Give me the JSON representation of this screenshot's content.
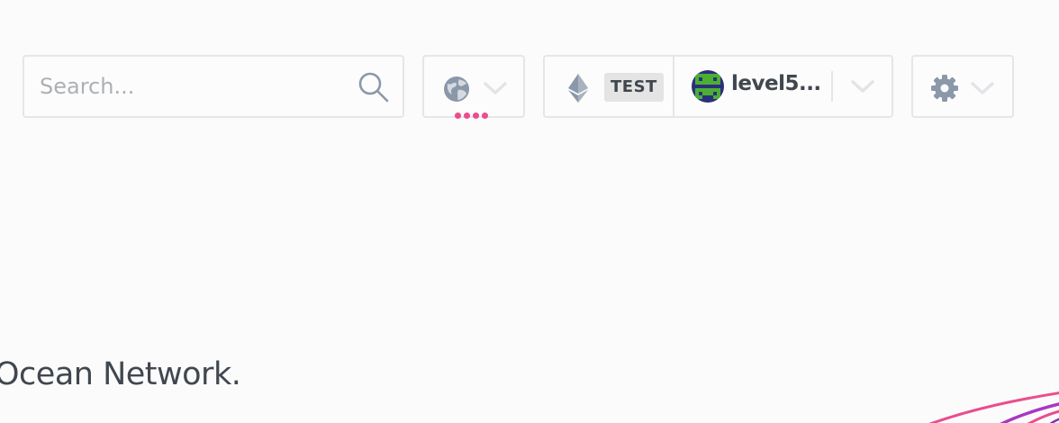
{
  "header": {
    "search": {
      "placeholder": "Search...",
      "value": "",
      "icon": "search-icon"
    },
    "network_selector": {
      "icon": "globe-icon",
      "chevron": "chevron-down-icon",
      "status_color": "#e94e8e"
    },
    "wallet": {
      "network_icon": "eth-icon",
      "network_badge": "TEST",
      "account_name": "level5...",
      "avatar": "pixel-avatar",
      "chevron": "chevron-down-icon"
    },
    "settings": {
      "icon": "gear-icon",
      "chevron": "chevron-down-icon"
    }
  },
  "main": {
    "tagline": "Ocean Network."
  },
  "colors": {
    "accent_pink": "#e94e8e",
    "accent_purple": "#a838c2",
    "text": "#41474e",
    "border": "#e6e6e6",
    "icon_gray": "#8b98a9"
  }
}
